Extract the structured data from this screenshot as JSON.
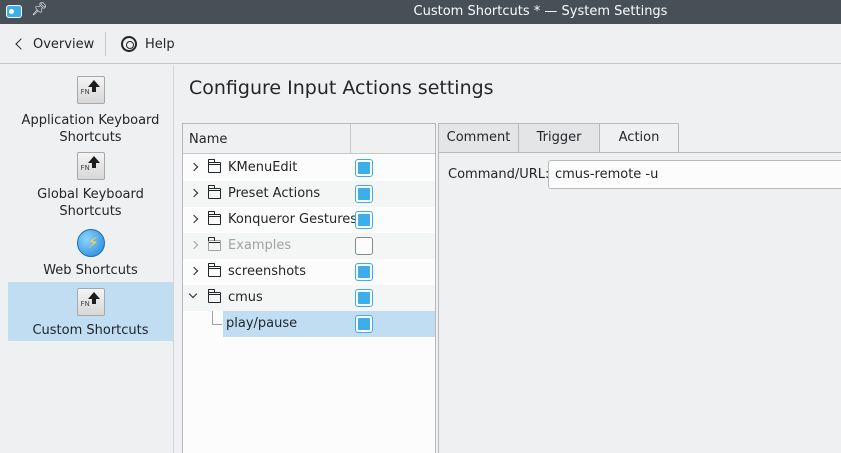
{
  "window": {
    "title": "Custom Shortcuts * — System Settings"
  },
  "toolbar": {
    "overview_label": "Overview",
    "help_label": "Help"
  },
  "sidebar": {
    "items": [
      {
        "label": "Application Keyboard Shortcuts",
        "icon": "fn-key-icon"
      },
      {
        "label": "Global Keyboard Shortcuts",
        "icon": "fn-key-icon"
      },
      {
        "label": "Web Shortcuts",
        "icon": "web-globe-icon"
      },
      {
        "label": "Custom Shortcuts",
        "icon": "fn-key-icon",
        "selected": true
      }
    ]
  },
  "main": {
    "title": "Configure Input Actions settings",
    "tree": {
      "header_name": "Name",
      "rows": [
        {
          "label": "KMenuEdit",
          "enabled": true,
          "expanded": false
        },
        {
          "label": "Preset Actions",
          "enabled": true,
          "expanded": false
        },
        {
          "label": "Konqueror Gestures",
          "enabled": true,
          "expanded": false
        },
        {
          "label": "Examples",
          "enabled": false,
          "expanded": false
        },
        {
          "label": "screenshots",
          "enabled": true,
          "expanded": false
        },
        {
          "label": "cmus",
          "enabled": true,
          "expanded": true
        },
        {
          "label": "play/pause",
          "enabled": true,
          "selected": true
        }
      ]
    },
    "tabs": [
      {
        "label": "Comment"
      },
      {
        "label": "Trigger"
      },
      {
        "label": "Action",
        "active": true
      }
    ],
    "action": {
      "command_label": "Command/URL:",
      "command_value": "cmus-remote -u"
    }
  },
  "colors": {
    "accent": "#3daee9",
    "selection": "#c1ddf1",
    "titlebar": "#475057"
  }
}
